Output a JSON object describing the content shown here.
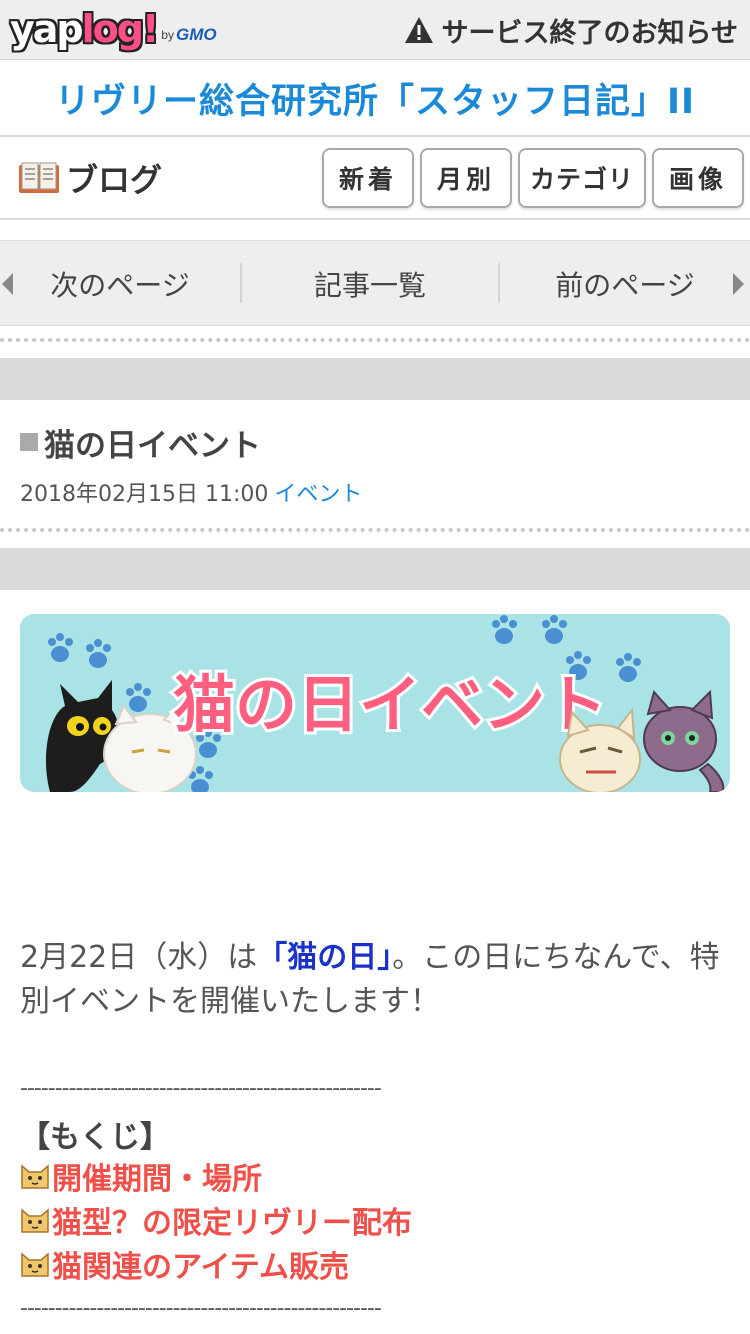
{
  "header": {
    "logo_main_1": "yap",
    "logo_main_2": "log!",
    "logo_by": "by",
    "logo_gmo": "GMO",
    "notice": "サービス終了のお知らせ"
  },
  "site": {
    "title": "リヴリー総合研究所「スタッフ日記」II"
  },
  "blogbar": {
    "label": "ブログ",
    "buttons": {
      "new": "新着",
      "month": "月別",
      "category": "カテゴリ",
      "image": "画像"
    }
  },
  "pager": {
    "next_page": "次のページ",
    "article_list": "記事一覧",
    "prev_page": "前のページ"
  },
  "article": {
    "title": "猫の日イベント",
    "date": "2018年02月15日 11:00",
    "category": "イベント",
    "banner_text": "猫の日イベント",
    "body_pre": "2月22日（水）は",
    "body_highlight": "「猫の日」",
    "body_post": "。この日にちなんで、特別イベントを開催いたします！",
    "rule": "----------------------------------------------------",
    "toc_heading": "【もくじ】",
    "toc": [
      "開催期間・場所",
      "猫型？の限定リヴリー配布",
      "猫関連のアイテム販売"
    ]
  },
  "colors": {
    "accent_blue": "#1a8ad8",
    "toc_red": "#f0504a",
    "banner_bg": "#a9e3e6",
    "banner_text": "#ff5f7e"
  },
  "icons": {
    "warning": "warning-icon",
    "book": "book-icon",
    "cat": "cat-face-icon"
  }
}
